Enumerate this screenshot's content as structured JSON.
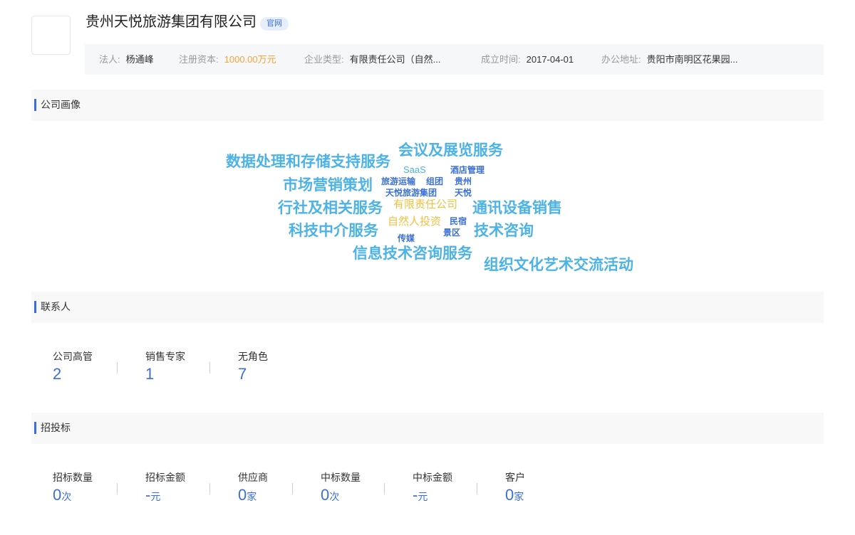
{
  "company": {
    "name": "贵州天悦旅游集团有限公司",
    "tag": "官网"
  },
  "info": [
    {
      "label": "法人:",
      "value": "杨通峰"
    },
    {
      "label": "注册资本:",
      "value": "1000.00万元"
    },
    {
      "label": "企业类型:",
      "value": "有限责任公司（自然..."
    },
    {
      "label": "成立时间:",
      "value": "2017-04-01"
    },
    {
      "label": "办公地址:",
      "value": "贵阳市南明区花果园..."
    }
  ],
  "sections": {
    "portrait": "公司画像",
    "contacts": "联系人",
    "bids": "招投标"
  },
  "colors": {
    "accent": "#3b6fd6",
    "cloud_light_blue": "#4db3e6",
    "cloud_dark_blue": "#3b6fd6",
    "cloud_orange": "#f0c040"
  },
  "word_cloud": [
    {
      "text": "数据处理和存储支持服务",
      "color": "#4db3e6"
    },
    {
      "text": "会议及展览服务",
      "color": "#4db3e6"
    },
    {
      "text": "SaaS",
      "color": "#4db3e6"
    },
    {
      "text": "酒店管理",
      "color": "#3b6fd6"
    },
    {
      "text": "市场营销策划",
      "color": "#4db3e6"
    },
    {
      "text": "旅游运输",
      "color": "#3b6fd6"
    },
    {
      "text": "组团",
      "color": "#3b6fd6"
    },
    {
      "text": "贵州",
      "color": "#3b6fd6"
    },
    {
      "text": "天悦旅游集团",
      "color": "#3b6fd6"
    },
    {
      "text": "天悦",
      "color": "#3b6fd6"
    },
    {
      "text": "行社及相关服务",
      "color": "#4db3e6"
    },
    {
      "text": "有限责任公司",
      "color": "#f0c040"
    },
    {
      "text": "通讯设备销售",
      "color": "#4db3e6"
    },
    {
      "text": "自然人投资",
      "color": "#f0c040"
    },
    {
      "text": "民宿",
      "color": "#3b6fd6"
    },
    {
      "text": "科技中介服务",
      "color": "#4db3e6"
    },
    {
      "text": "景区",
      "color": "#3b6fd6"
    },
    {
      "text": "技术咨询",
      "color": "#4db3e6"
    },
    {
      "text": "传媒",
      "color": "#3b6fd6"
    },
    {
      "text": "信息技术咨询服务",
      "color": "#4db3e6"
    },
    {
      "text": "组织文化艺术交流活动",
      "color": "#4db3e6"
    }
  ],
  "contacts": [
    {
      "label": "公司高管",
      "value": "2"
    },
    {
      "label": "销售专家",
      "value": "1"
    },
    {
      "label": "无角色",
      "value": "7"
    }
  ],
  "bids": [
    {
      "label": "招标数量",
      "value": "0",
      "unit": "次"
    },
    {
      "label": "招标金额",
      "value": "-",
      "unit": "元"
    },
    {
      "label": "供应商",
      "value": "0",
      "unit": "家"
    },
    {
      "label": "中标数量",
      "value": "0",
      "unit": "次"
    },
    {
      "label": "中标金额",
      "value": "-",
      "unit": "元"
    },
    {
      "label": "客户",
      "value": "0",
      "unit": "家"
    }
  ]
}
